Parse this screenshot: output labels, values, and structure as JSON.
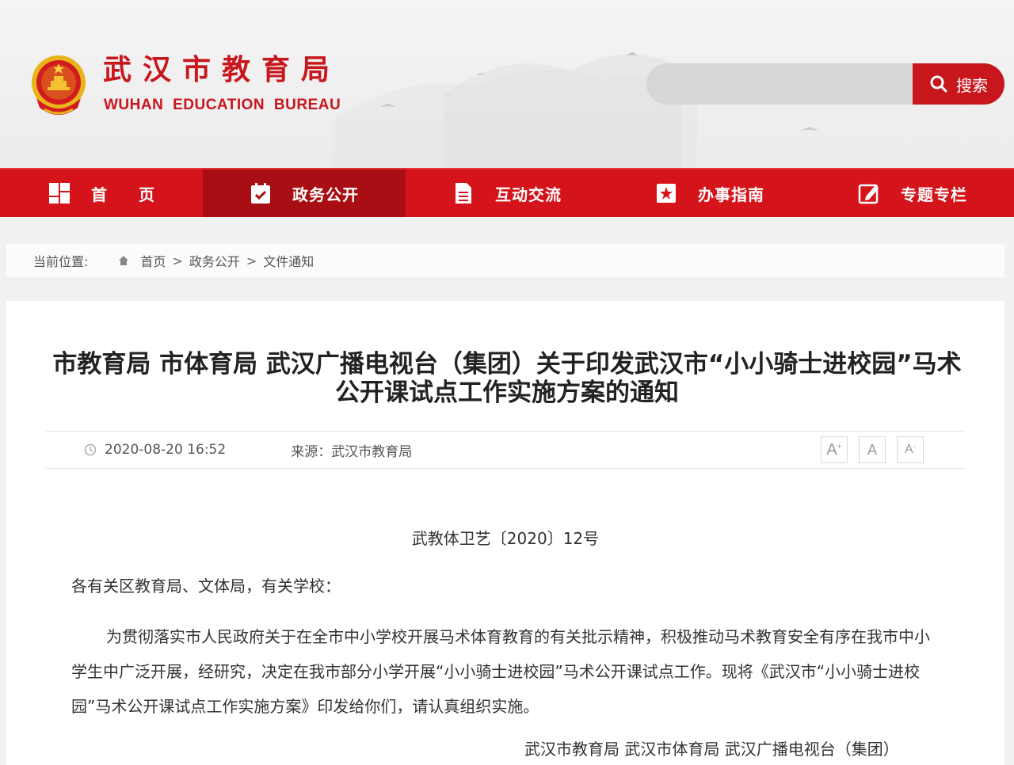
{
  "header": {
    "site_title": "武汉市教育局",
    "site_subtitle": "WUHAN EDUCATION BUREAU",
    "search_button_label": "搜索"
  },
  "nav": [
    {
      "label": "首页",
      "icon": "home-grid-icon"
    },
    {
      "label": "政务公开",
      "icon": "calendar-check-icon"
    },
    {
      "label": "互动交流",
      "icon": "document-icon"
    },
    {
      "label": "办事指南",
      "icon": "star-square-icon"
    },
    {
      "label": "专题专栏",
      "icon": "edit-icon"
    }
  ],
  "breadcrumb": {
    "label": "当前位置:",
    "items": [
      "首页",
      "政务公开",
      "文件通知"
    ],
    "separator": ">"
  },
  "article": {
    "title": "市教育局 市体育局 武汉广播电视台（集团）关于印发武汉市“小小骑士进校园”马术公开课试点工作实施方案的通知",
    "date": "2020-08-20 16:52",
    "source": "来源：武汉市教育局",
    "font_buttons": [
      "A+",
      "A",
      "A-"
    ],
    "doc_number": "武教体卫艺〔2020〕12号",
    "salutation": "各有关区教育局、文体局，有关学校：",
    "body": "为贯彻落实市人民政府关于在全市中小学校开展马术体育教育的有关批示精神，积极推动马术教育安全有序在我市中小学生中广泛开展，经研究，决定在我市部分小学开展“小小骑士进校园”马术公开课试点工作。现将《武汉市“小小骑士进校园”马术公开课试点工作实施方案》印发给你们，请认真组织实施。",
    "signature": "武汉市教育局 武汉市体育局 武汉广播电视台（集团）"
  },
  "colors": {
    "brand_red": "#c8161d",
    "nav_red": "#d4131a",
    "nav_active": "#a80e13"
  }
}
